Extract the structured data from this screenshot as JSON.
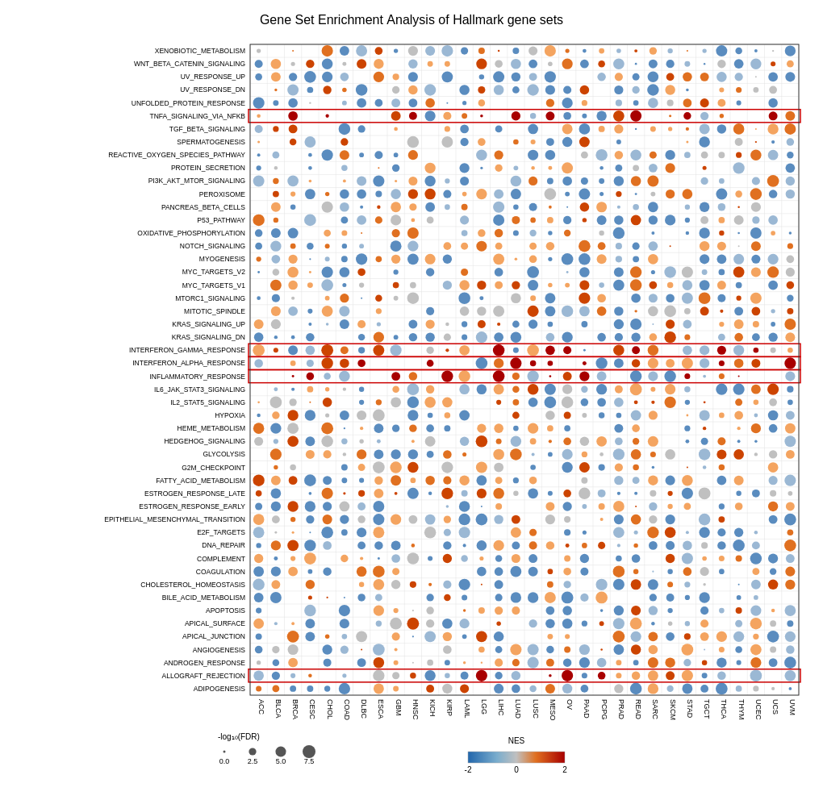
{
  "title": "Gene Set Enrichment Analysis of Hallmark gene sets",
  "yLabels": [
    "XENOBIOTIC_METABOLISM",
    "WNT_BETA_CATENIN_SIGNALING",
    "UV_RESPONSE_UP",
    "UV_RESPONSE_DN",
    "UNFOLDED_PROTEIN_RESPONSE",
    "TNFA_SIGNALING_VIA_NFKB",
    "TGF_BETA_SIGNALING",
    "SPERMATOGENESIS",
    "REACTIVE_OXYGEN_SPECIES_PATHWAY",
    "PROTEIN_SECRETION",
    "PI3K_AKT_MTOR_SIGNALING",
    "PEROXISOME",
    "PANCREAS_BETA_CELLS",
    "P53_PATHWAY",
    "OXIDATIVE_PHOSPHORYLATION",
    "NOTCH_SIGNALING",
    "MYOGENESIS",
    "MYC_TARGETS_V2",
    "MYC_TARGETS_V1",
    "MTORC1_SIGNALING",
    "MITOTIC_SPINDLE",
    "KRAS_SIGNALING_UP",
    "KRAS_SIGNALING_DN",
    "INTERFERON_GAMMA_RESPONSE",
    "INTERFERON_ALPHA_RESPONSE",
    "INFLAMMATORY_RESPONSE",
    "IL6_JAK_STAT3_SIGNALING",
    "IL2_STAT5_SIGNALING",
    "HYPOXIA",
    "HEME_METABOLISM",
    "HEDGEHOG_SIGNALING",
    "GLYCOLYSIS",
    "G2M_CHECKPOINT",
    "FATTY_ACID_METABOLISM",
    "ESTROGEN_RESPONSE_LATE",
    "ESTROGEN_RESPONSE_EARLY",
    "EPITHELIAL_MESENCHYMAL_TRANSITION",
    "E2F_TARGETS",
    "DNA_REPAIR",
    "COMPLEMENT",
    "COAGULATION",
    "CHOLESTEROL_HOMEOSTASIS",
    "BILE_ACID_METABOLISM",
    "APOPTOSIS",
    "APICAL_SURFACE",
    "APICAL_JUNCTION",
    "ANGIOGENESIS",
    "ANDROGEN_RESPONSE",
    "ALLOGRAFT_REJECTION",
    "ADIPOGENESIS"
  ],
  "xLabels": [
    "ACC",
    "BLCA",
    "BRCA",
    "CESC",
    "CHOL",
    "COAD",
    "DLBC",
    "ESCA",
    "GBM",
    "HNSC",
    "KICH",
    "KIRP",
    "LAML",
    "LGG",
    "LIHC",
    "LUAD",
    "LUSC",
    "MESO",
    "OV",
    "PAAD",
    "PCPG",
    "PRAD",
    "READ",
    "SARC",
    "SKCM",
    "STAD",
    "TGCT",
    "THCA",
    "THYM",
    "UCEC",
    "UCS",
    "UVM"
  ],
  "highlightedRows": [
    "TNFA_SIGNALING_VIA_NFKB",
    "INTERFERON_GAMMA_RESPONSE",
    "INTERFERON_ALPHA_RESPONSE",
    "INFLAMMATORY_RESPONSE",
    "ALLOGRAFT_REJECTION"
  ],
  "legend": {
    "fdrTitle": "-log10(FDR)",
    "fdrValues": [
      "0.0",
      "2.5",
      "5.0",
      "7.5"
    ],
    "nesTitle": "NES",
    "nesMin": -2,
    "nesMax": 2
  }
}
